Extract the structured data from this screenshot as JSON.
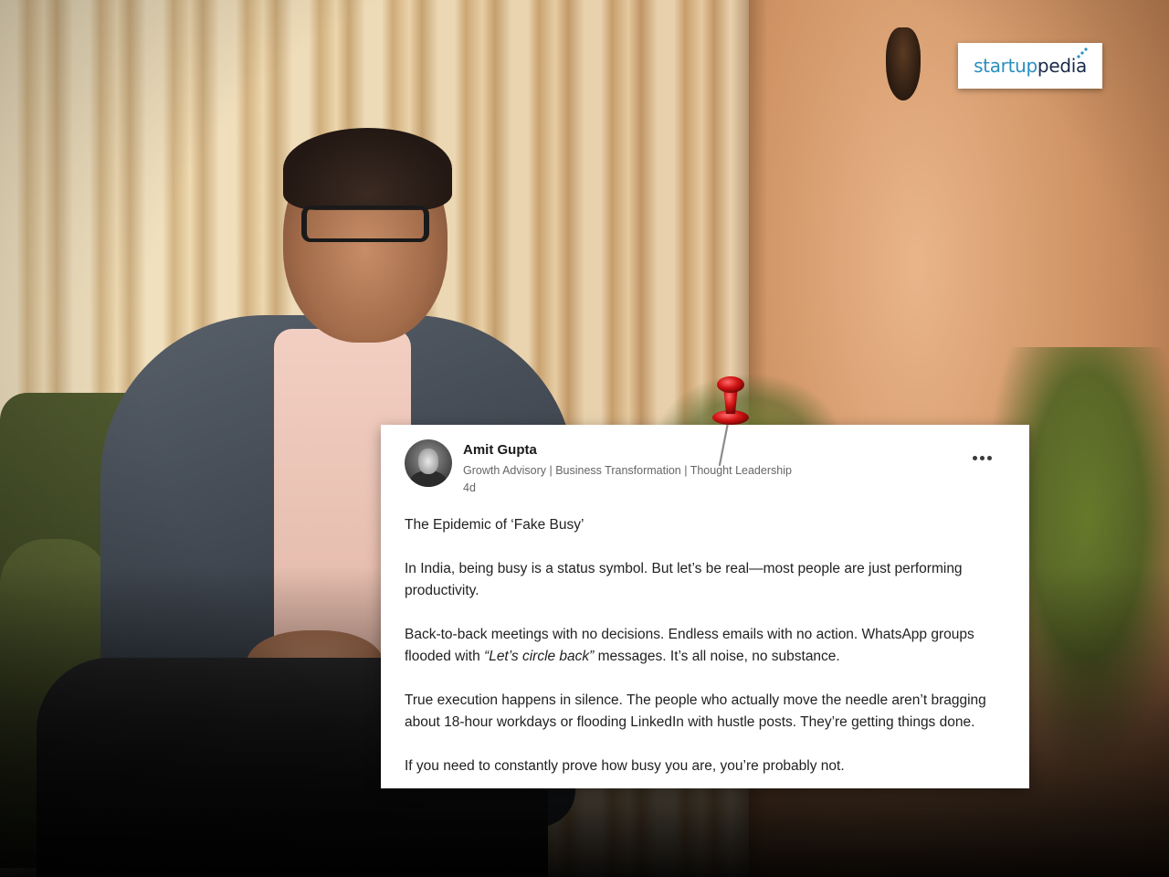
{
  "logo": {
    "part_a": "startup",
    "part_b": "pedia",
    "colors": {
      "primary": "#2a8fc0",
      "secondary": "#1a2a4a"
    }
  },
  "post": {
    "author_name": "Amit Gupta",
    "author_headline": "Growth Advisory | Business Transformation | Thought Leadership",
    "time": "4d",
    "title": "The Epidemic of ‘Fake Busy’",
    "paragraph_1": "In India, being busy is a status symbol. But let’s be real—most people are just performing productivity.",
    "paragraph_2_before": "Back-to-back meetings with no decisions. Endless emails with no action. WhatsApp groups flooded with ",
    "paragraph_2_italic": "“Let’s circle back”",
    "paragraph_2_after": " messages. It’s all noise, no substance.",
    "paragraph_3": "True execution happens in silence. The people who actually move the needle aren’t bragging about 18-hour workdays or flooding LinkedIn with hustle posts. They’re getting things done.",
    "paragraph_4": "If you need to constantly prove how busy you are, you’re probably not.",
    "icons": {
      "menu": "more-horizontal-icon",
      "pin": "push-pin-icon"
    }
  }
}
